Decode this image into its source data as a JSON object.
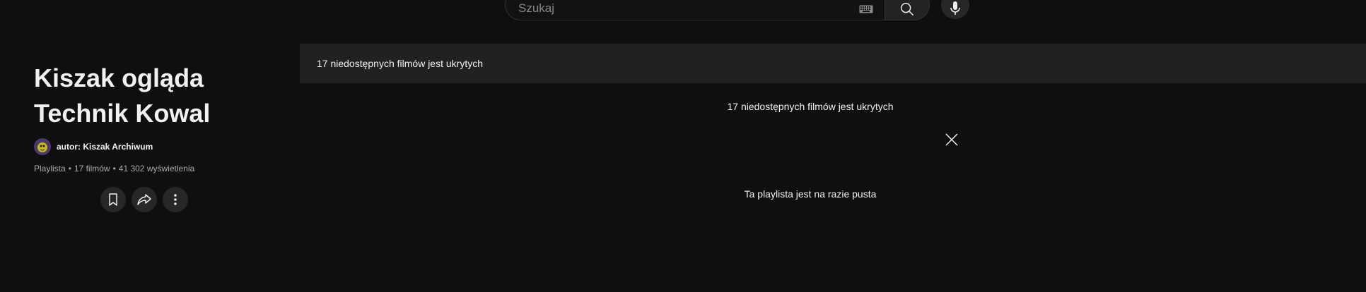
{
  "search": {
    "placeholder": "Szukaj",
    "keyboard_icon": "keyboard-icon",
    "search_icon": "search-icon",
    "mic_icon": "microphone-icon"
  },
  "playlist": {
    "title_line1": "Kiszak ogląda",
    "title_line2": "Technik Kowal",
    "owner_label": "autor: Kiszak Archiwum",
    "meta": {
      "type": "Playlista",
      "video_count": "17 filmów",
      "views": "41 302 wyświetlenia"
    },
    "actions": [
      {
        "icon": "save-icon"
      },
      {
        "icon": "share-icon"
      },
      {
        "icon": "more-vertical-icon"
      }
    ]
  },
  "content": {
    "banner_text": "17 niedostępnych filmów jest ukrytych",
    "notice_text": "17 niedostępnych filmów jest ukrytych",
    "close_icon": "close-icon",
    "empty_text": "Ta playlista jest na razie pusta"
  },
  "colors": {
    "background": "#0f0f0f",
    "banner": "#212121",
    "button": "#272727",
    "text_primary": "#f1f1f1",
    "text_secondary": "#aaaaaa"
  }
}
